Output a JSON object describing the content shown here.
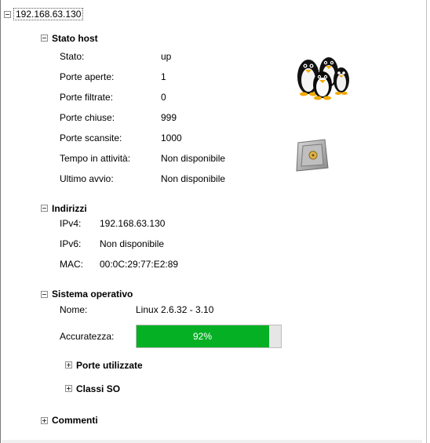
{
  "root": {
    "label": "192.168.63.130"
  },
  "host_status": {
    "title": "Stato host",
    "rows": [
      {
        "label": "Stato:",
        "value": "up"
      },
      {
        "label": "Porte aperte:",
        "value": "1"
      },
      {
        "label": "Porte filtrate:",
        "value": "0"
      },
      {
        "label": "Porte chiuse:",
        "value": "999"
      },
      {
        "label": "Porte scansite:",
        "value": "1000"
      },
      {
        "label": "Tempo in attività:",
        "value": "Non disponibile"
      },
      {
        "label": "Ultimo avvio:",
        "value": "Non disponibile"
      }
    ],
    "os_icon": "linux-penguins-icon",
    "security_icon": "safe-vault-icon"
  },
  "addresses": {
    "title": "Indirizzi",
    "rows": [
      {
        "label": "IPv4:",
        "value": "192.168.63.130"
      },
      {
        "label": "IPv6:",
        "value": "Non disponibile"
      },
      {
        "label": "MAC:",
        "value": "00:0C:29:77:E2:89"
      }
    ]
  },
  "os": {
    "title": "Sistema operativo",
    "name_label": "Nome:",
    "name_value": "Linux 2.6.32 - 3.10",
    "accuracy_label": "Accuratezza:",
    "accuracy_value": 92,
    "accuracy_text": "92%",
    "accent": "#06b025",
    "ports_used": "Porte utilizzate",
    "os_classes": "Classi SO"
  },
  "comments": {
    "title": "Commenti"
  }
}
